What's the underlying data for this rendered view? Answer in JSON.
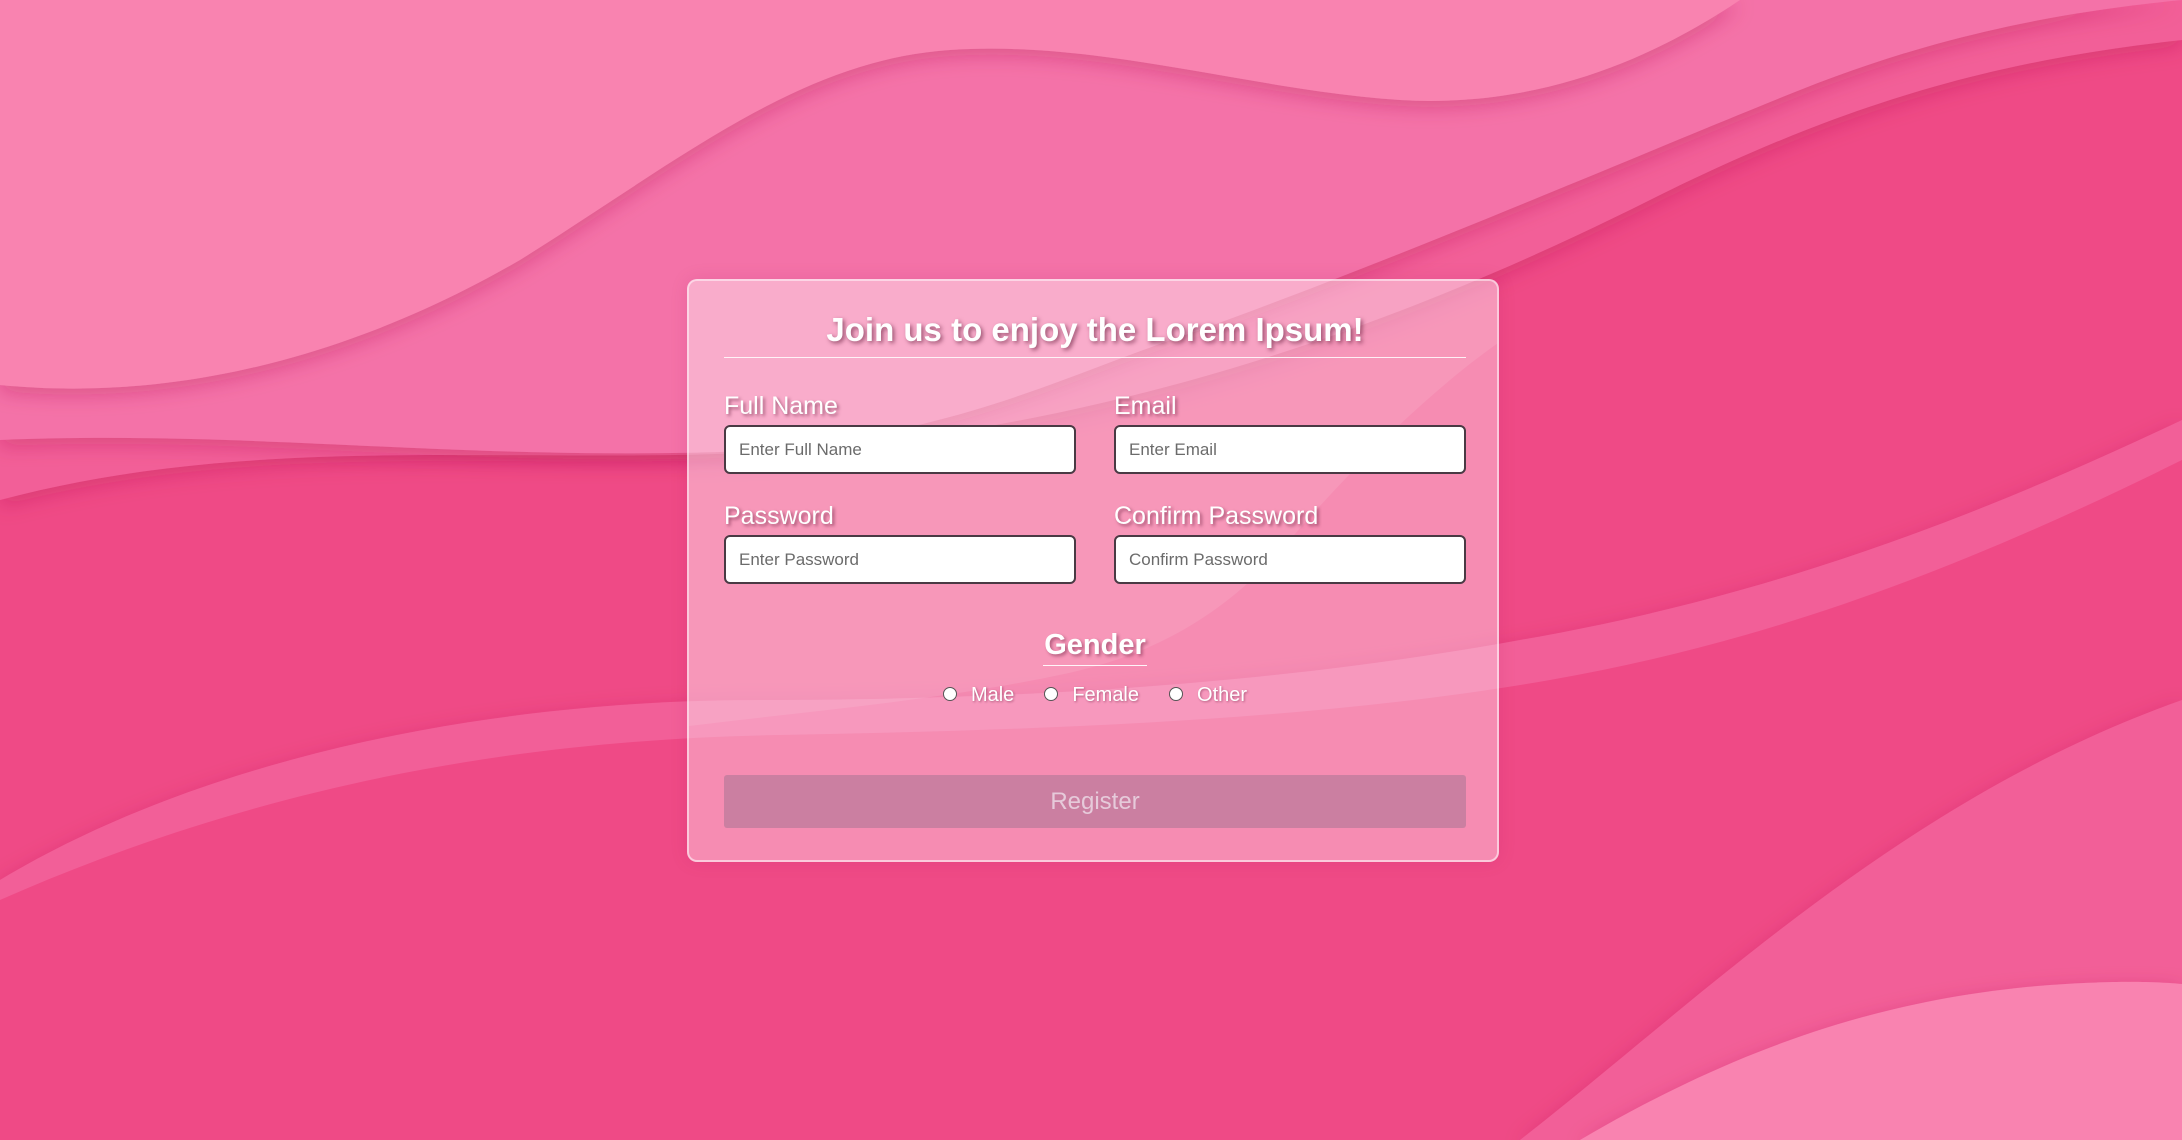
{
  "form": {
    "title": "Join us to enjoy the Lorem Ipsum!",
    "fields": {
      "full_name": {
        "label": "Full Name",
        "placeholder": "Enter Full Name",
        "value": ""
      },
      "email": {
        "label": "Email",
        "placeholder": "Enter Email",
        "value": ""
      },
      "password": {
        "label": "Password",
        "placeholder": "Enter Password",
        "value": ""
      },
      "confirm_password": {
        "label": "Confirm Password",
        "placeholder": "Confirm Password",
        "value": ""
      }
    },
    "gender": {
      "title": "Gender",
      "options": [
        "Male",
        "Female",
        "Other"
      ],
      "selected": null
    },
    "register_label": "Register"
  },
  "colors": {
    "background": "#f26a9f",
    "wave_light": "#f983b0",
    "wave_dark": "#ef4a86",
    "card_overlay": "#ffe6f0",
    "button": "#966e8c"
  }
}
